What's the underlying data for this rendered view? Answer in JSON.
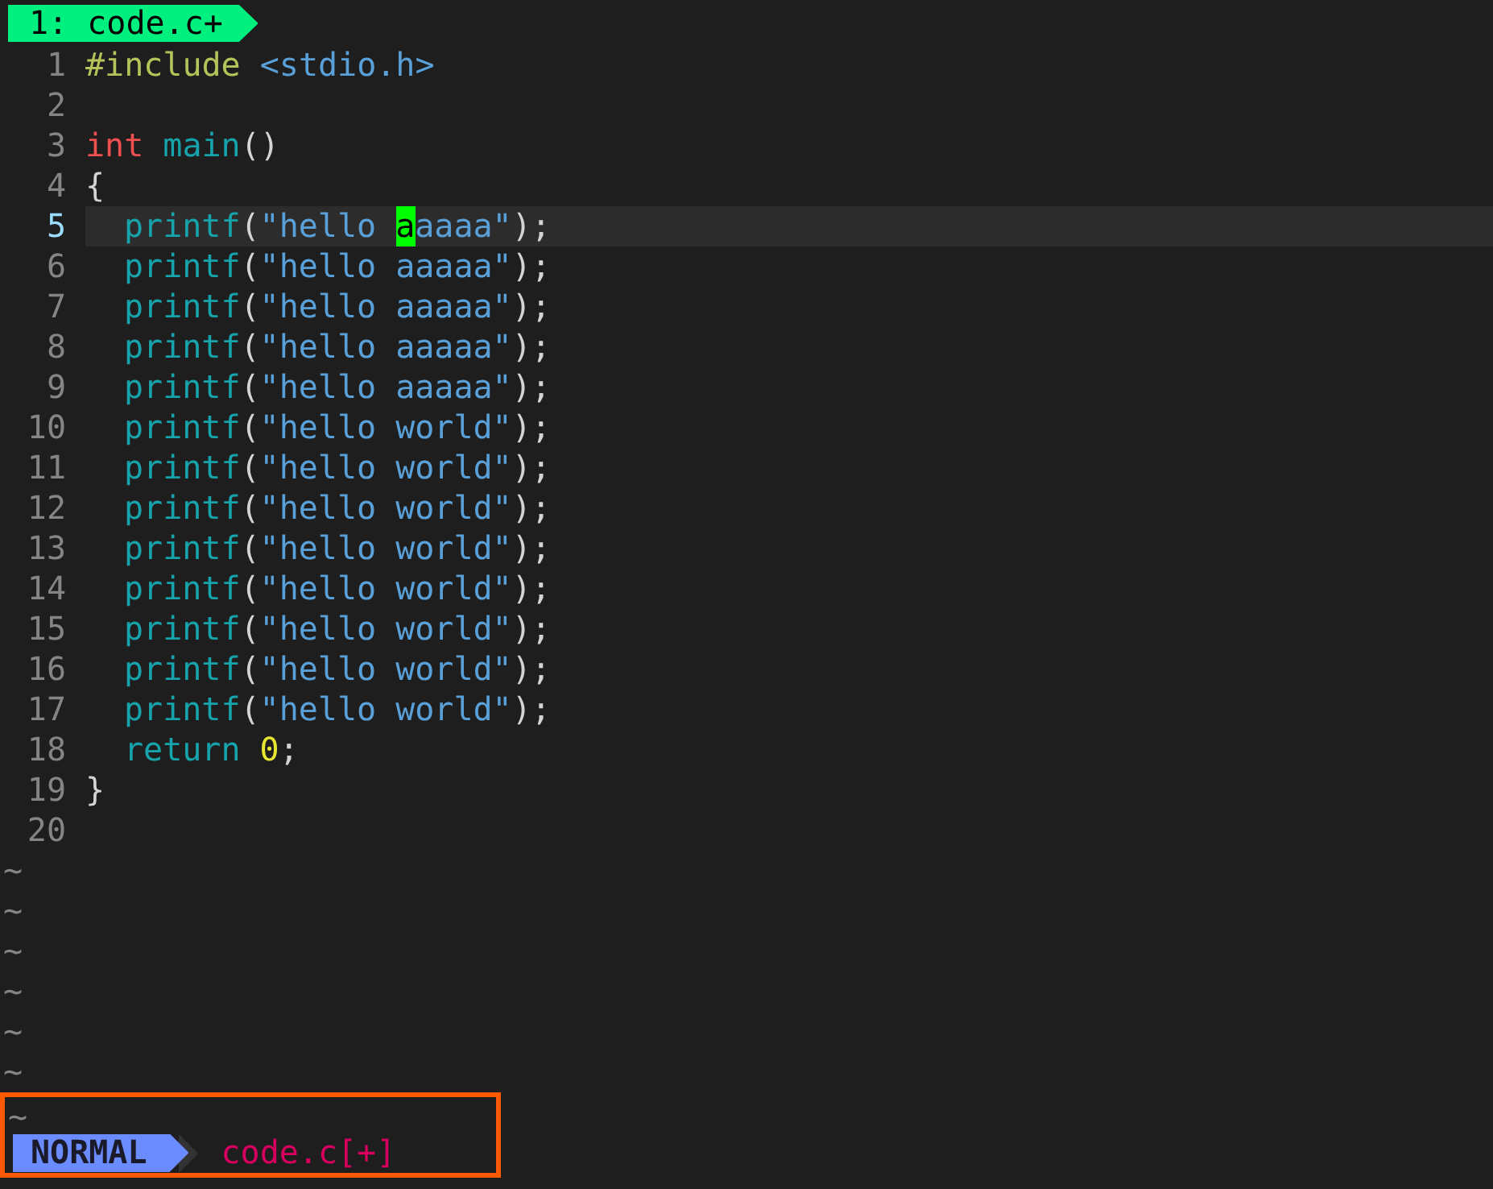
{
  "tabline": {
    "tab": "1: code.c+"
  },
  "lines": [
    {
      "number": "1",
      "current": false,
      "indented": false,
      "tokens": [
        {
          "kind": "preproc",
          "text": "#include "
        },
        {
          "kind": "header",
          "text": "<stdio.h>"
        }
      ]
    },
    {
      "number": "2",
      "current": false
    },
    {
      "number": "3",
      "current": false,
      "indented": false,
      "tokens": [
        {
          "kind": "type",
          "text": "int "
        },
        {
          "kind": "func",
          "text": "main"
        },
        {
          "kind": "punct",
          "text": "()"
        }
      ]
    },
    {
      "number": "4",
      "current": false,
      "indented": false,
      "tokens": [
        {
          "kind": "punct",
          "text": "{"
        }
      ]
    },
    {
      "number": "5",
      "current": true,
      "indented": true,
      "tokens": [
        {
          "kind": "func",
          "text": "printf"
        },
        {
          "kind": "punct",
          "text": "("
        },
        {
          "kind": "string",
          "text": "\"hello "
        },
        {
          "kind": "cursor",
          "text": "a"
        },
        {
          "kind": "string",
          "text": "aaaa\""
        },
        {
          "kind": "punct",
          "text": ");"
        }
      ]
    },
    {
      "number": "6",
      "current": false,
      "indented": true,
      "tokens": [
        {
          "kind": "func",
          "text": "printf"
        },
        {
          "kind": "punct",
          "text": "("
        },
        {
          "kind": "string",
          "text": "\"hello aaaaa\""
        },
        {
          "kind": "punct",
          "text": ");"
        }
      ]
    },
    {
      "number": "7",
      "current": false,
      "indented": true,
      "tokens": [
        {
          "kind": "func",
          "text": "printf"
        },
        {
          "kind": "punct",
          "text": "("
        },
        {
          "kind": "string",
          "text": "\"hello aaaaa\""
        },
        {
          "kind": "punct",
          "text": ");"
        }
      ]
    },
    {
      "number": "8",
      "current": false,
      "indented": true,
      "tokens": [
        {
          "kind": "func",
          "text": "printf"
        },
        {
          "kind": "punct",
          "text": "("
        },
        {
          "kind": "string",
          "text": "\"hello aaaaa\""
        },
        {
          "kind": "punct",
          "text": ");"
        }
      ]
    },
    {
      "number": "9",
      "current": false,
      "indented": true,
      "tokens": [
        {
          "kind": "func",
          "text": "printf"
        },
        {
          "kind": "punct",
          "text": "("
        },
        {
          "kind": "string",
          "text": "\"hello aaaaa\""
        },
        {
          "kind": "punct",
          "text": ");"
        }
      ]
    },
    {
      "number": "10",
      "current": false,
      "indented": true,
      "tokens": [
        {
          "kind": "func",
          "text": "printf"
        },
        {
          "kind": "punct",
          "text": "("
        },
        {
          "kind": "string",
          "text": "\"hello world\""
        },
        {
          "kind": "punct",
          "text": ");"
        }
      ]
    },
    {
      "number": "11",
      "current": false,
      "indented": true,
      "tokens": [
        {
          "kind": "func",
          "text": "printf"
        },
        {
          "kind": "punct",
          "text": "("
        },
        {
          "kind": "string",
          "text": "\"hello world\""
        },
        {
          "kind": "punct",
          "text": ");"
        }
      ]
    },
    {
      "number": "12",
      "current": false,
      "indented": true,
      "tokens": [
        {
          "kind": "func",
          "text": "printf"
        },
        {
          "kind": "punct",
          "text": "("
        },
        {
          "kind": "string",
          "text": "\"hello world\""
        },
        {
          "kind": "punct",
          "text": ");"
        }
      ]
    },
    {
      "number": "13",
      "current": false,
      "indented": true,
      "tokens": [
        {
          "kind": "func",
          "text": "printf"
        },
        {
          "kind": "punct",
          "text": "("
        },
        {
          "kind": "string",
          "text": "\"hello world\""
        },
        {
          "kind": "punct",
          "text": ");"
        }
      ]
    },
    {
      "number": "14",
      "current": false,
      "indented": true,
      "tokens": [
        {
          "kind": "func",
          "text": "printf"
        },
        {
          "kind": "punct",
          "text": "("
        },
        {
          "kind": "string",
          "text": "\"hello world\""
        },
        {
          "kind": "punct",
          "text": ");"
        }
      ]
    },
    {
      "number": "15",
      "current": false,
      "indented": true,
      "tokens": [
        {
          "kind": "func",
          "text": "printf"
        },
        {
          "kind": "punct",
          "text": "("
        },
        {
          "kind": "string",
          "text": "\"hello world\""
        },
        {
          "kind": "punct",
          "text": ");"
        }
      ]
    },
    {
      "number": "16",
      "current": false,
      "indented": true,
      "tokens": [
        {
          "kind": "func",
          "text": "printf"
        },
        {
          "kind": "punct",
          "text": "("
        },
        {
          "kind": "string",
          "text": "\"hello world\""
        },
        {
          "kind": "punct",
          "text": ");"
        }
      ]
    },
    {
      "number": "17",
      "current": false,
      "indented": true,
      "tokens": [
        {
          "kind": "func",
          "text": "printf"
        },
        {
          "kind": "punct",
          "text": "("
        },
        {
          "kind": "string",
          "text": "\"hello world\""
        },
        {
          "kind": "punct",
          "text": ");"
        }
      ]
    },
    {
      "number": "18",
      "current": false,
      "indented": true,
      "tokens": [
        {
          "kind": "keyword",
          "text": "return "
        },
        {
          "kind": "number",
          "text": "0"
        },
        {
          "kind": "punct",
          "text": ";"
        }
      ]
    },
    {
      "number": "19",
      "current": false,
      "indented": false,
      "tokens": [
        {
          "kind": "punct",
          "text": "}"
        }
      ]
    },
    {
      "number": "20",
      "current": false
    }
  ],
  "filler": [
    "~",
    "~",
    "~",
    "~",
    "~",
    "~",
    "~"
  ],
  "status_bar": {
    "highlighted": true,
    "mode": "NORMAL",
    "file": "code.c[+]"
  }
}
